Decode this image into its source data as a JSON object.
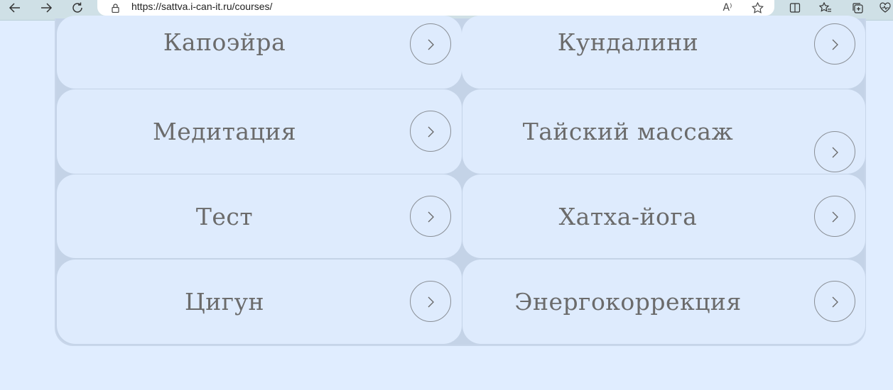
{
  "browser": {
    "url": "https://sattva.i-can-it.ru/courses/",
    "icons": [
      "back-icon",
      "forward-icon",
      "refresh-icon",
      "lock-icon",
      "read-aloud-icon",
      "favorite-star-icon",
      "split-screen-icon",
      "favorites-icon",
      "collections-icon",
      "heart-pulse-icon"
    ],
    "read_aloud_label": "A⁾"
  },
  "courses": [
    {
      "label": "Капоэйра"
    },
    {
      "label": "Кундалини"
    },
    {
      "label": "Медитация"
    },
    {
      "label": "Тайский массаж"
    },
    {
      "label": "Тест"
    },
    {
      "label": "Хатха-йога"
    },
    {
      "label": "Цигун"
    },
    {
      "label": "Энергокоррекция"
    }
  ],
  "colors": {
    "page_background": "#e0edff",
    "card_background": "#deebfd",
    "grid_gap": "#c4d3e7",
    "label_text": "#6b6b6b",
    "browser_toolbar": "#cfe0e6"
  }
}
